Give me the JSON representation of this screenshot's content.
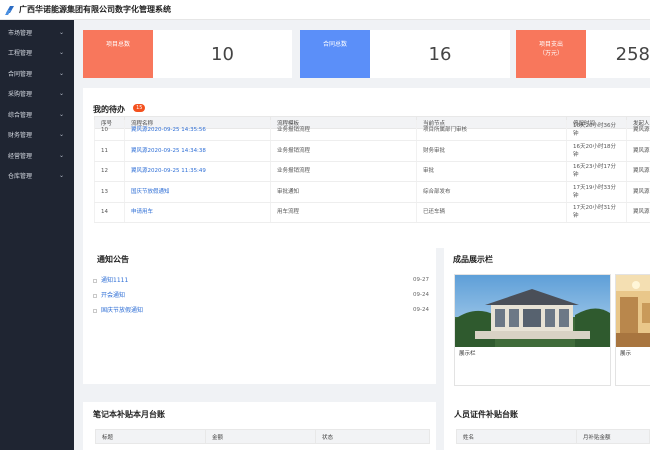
{
  "app": {
    "title": "广西华诺能源集团有限公司数字化管理系统"
  },
  "sidebar": {
    "items": [
      {
        "label": "市场管理"
      },
      {
        "label": "工程管理"
      },
      {
        "label": "合同管理"
      },
      {
        "label": "采购管理"
      },
      {
        "label": "综合管理"
      },
      {
        "label": "财务管理"
      },
      {
        "label": "经营管理"
      },
      {
        "label": "仓库管理"
      }
    ]
  },
  "stats": [
    {
      "label_line1": "项目总数",
      "label_line2": "",
      "value": "10",
      "color": "#f8775c"
    },
    {
      "label_line1": "合同总数",
      "label_line2": "",
      "value": "16",
      "color": "#5b8ff9"
    },
    {
      "label_line1": "项目支出",
      "label_line2": "（万元）",
      "value": "258",
      "color": "#f8775c"
    }
  ],
  "todo": {
    "title": "我的待办",
    "badge": "15",
    "headers": [
      "序号",
      "流程名称",
      "流程模板",
      "当前节点",
      "停留时间",
      "发起人"
    ],
    "rows": [
      {
        "no": "10",
        "name": "翼风源2020-09-25 14:35:56",
        "template": "业务报销流程",
        "node": "项目所属部门审核",
        "stay1": "16天20小时36分",
        "stay2": "钟",
        "initiator": "翼风源"
      },
      {
        "no": "11",
        "name": "翼风源2020-09-25 14:34:38",
        "template": "业务报销流程",
        "node": "财务审批",
        "stay1": "16天20小时18分",
        "stay2": "钟",
        "initiator": "翼风源"
      },
      {
        "no": "12",
        "name": "翼风源2020-09-25 11:35:49",
        "template": "业务报销流程",
        "node": "审批",
        "stay1": "16天23小时17分",
        "stay2": "钟",
        "initiator": "翼风源"
      },
      {
        "no": "13",
        "name": "国庆节放假通知",
        "template": "审批通知",
        "node": "综合部发布",
        "stay1": "17天19小时33分",
        "stay2": "钟",
        "initiator": "翼风源"
      },
      {
        "no": "14",
        "name": "申请用车",
        "template": "用车流程",
        "node": "已还车辆",
        "stay1": "17天20小时31分",
        "stay2": "钟",
        "initiator": "翼风源"
      }
    ]
  },
  "notices": {
    "title": "通知公告",
    "items": [
      {
        "text": "通知1111",
        "date": "09-27"
      },
      {
        "text": "开会通知",
        "date": "09-24"
      },
      {
        "text": "国庆节放假通知",
        "date": "09-24"
      }
    ]
  },
  "showcase": {
    "title": "成品展示栏",
    "cards": [
      {
        "caption": "展示栏"
      },
      {
        "caption": "展示"
      }
    ]
  },
  "notebook": {
    "title": "笔记本补贴本月台账",
    "headers": [
      "标题",
      "金额",
      "状态"
    ]
  },
  "certs": {
    "title": "人员证件补贴台账",
    "headers": [
      "姓名",
      "月补贴金额"
    ]
  }
}
